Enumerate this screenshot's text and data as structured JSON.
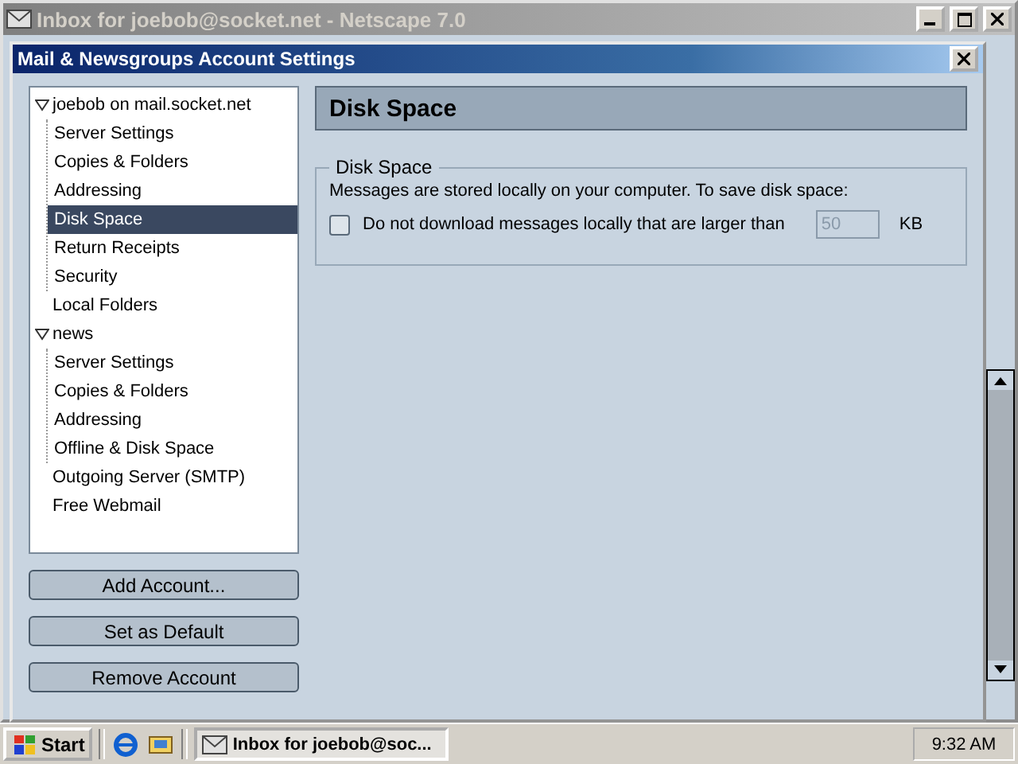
{
  "background_window": {
    "title": "Inbox for joebob@socket.net - Netscape 7.0",
    "active": false
  },
  "dialog": {
    "title": "Mail & Newsgroups Account Settings"
  },
  "tree": [
    {
      "label": "joebob on mail.socket.net",
      "selected": false,
      "expanded": true,
      "children": [
        {
          "label": "Server Settings",
          "selected": false
        },
        {
          "label": "Copies & Folders",
          "selected": false
        },
        {
          "label": "Addressing",
          "selected": false
        },
        {
          "label": "Disk Space",
          "selected": true
        },
        {
          "label": "Return Receipts",
          "selected": false
        },
        {
          "label": "Security",
          "selected": false
        }
      ]
    },
    {
      "label": "Local Folders",
      "selected": false
    },
    {
      "label": "news",
      "selected": false,
      "expanded": true,
      "children": [
        {
          "label": "Server Settings",
          "selected": false
        },
        {
          "label": "Copies & Folders",
          "selected": false
        },
        {
          "label": "Addressing",
          "selected": false
        },
        {
          "label": "Offline & Disk Space",
          "selected": false
        }
      ]
    },
    {
      "label": "Outgoing Server (SMTP)",
      "selected": false
    },
    {
      "label": "Free Webmail",
      "selected": false
    }
  ],
  "buttons": [
    "Add Account...",
    "Set as Default",
    "Remove Account"
  ],
  "panel": {
    "heading": "Disk Space",
    "group_title": "Disk Space",
    "description": "Messages are stored locally on your computer. To save disk space:",
    "option": {
      "label": "Do not download messages locally that are larger than",
      "checked": false,
      "value": "50",
      "disabled": true,
      "unit": "KB"
    }
  },
  "taskbar": {
    "start": "Start",
    "task": "Inbox for joebob@soc...",
    "clock": "9:32 AM"
  }
}
